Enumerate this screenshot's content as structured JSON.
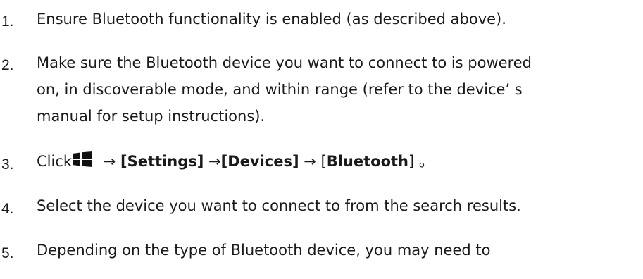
{
  "steps": [
    {
      "number": "1.",
      "lines": [
        "Ensure Bluetooth functionality is enabled (as described above)."
      ]
    },
    {
      "number": "2.",
      "lines": [
        "Make sure the Bluetooth device you want to connect to is powered",
        "on, in discoverable mode, and within range (refer to the device’ s",
        "manual for setup instructions)."
      ]
    },
    {
      "number": "3.",
      "prefix": "Click",
      "icon": "windows-start-icon",
      "arrow1": " → ",
      "settings": "[Settings]",
      "arrow2": " →",
      "devices": "[Devices]",
      "arrow3": " → ",
      "bt_open": "[",
      "bluetooth": "Bluetooth",
      "bt_close": "] 。"
    },
    {
      "number": "4.",
      "lines": [
        "Select the device you want to connect to from the search results."
      ]
    },
    {
      "number": "5.",
      "lines": [
        "Depending on the type of Bluetooth device, you may need to"
      ]
    }
  ]
}
